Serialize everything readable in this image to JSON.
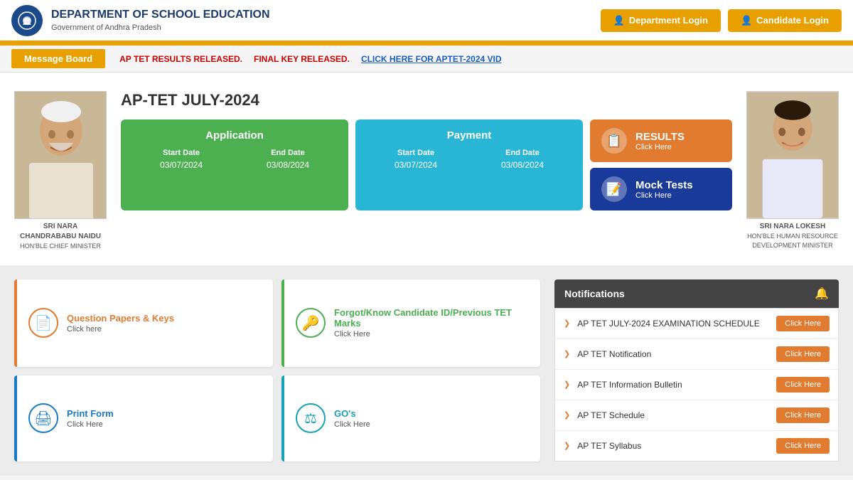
{
  "header": {
    "logo_text": "🏛",
    "title": "DEPARTMENT OF SCHOOL EDUCATION",
    "subtitle": "Government of Andhra Pradesh",
    "dept_login_label": "Department Login",
    "cand_login_label": "Candidate Login",
    "icon_dept": "👤",
    "icon_cand": "👤"
  },
  "message_bar": {
    "board_label": "Message Board",
    "msg1": "AP TET RESULTS RELEASED.",
    "msg2": "FINAL KEY RELEASED.",
    "msg3": "CLICK HERE FOR APTET-2024 VID"
  },
  "aptet": {
    "title": "AP-TET JULY-2024",
    "left_photo": {
      "name": "SRI NARA CHANDRABABU NAIDU",
      "role": "HON'BLE CHIEF MINISTER"
    },
    "right_photo": {
      "name": "SRI NARA LOKESH",
      "role": "HON'BLE HUMAN RESOURCE DEVELOPMENT MINISTER"
    },
    "application_card": {
      "title": "Application",
      "start_label": "Start Date",
      "start_value": "03/07/2024",
      "end_label": "End Date",
      "end_value": "03/08/2024"
    },
    "payment_card": {
      "title": "Payment",
      "start_label": "Start Date",
      "start_value": "03/07/2024",
      "end_label": "End Date",
      "end_value": "03/08/2024"
    },
    "results_card": {
      "title": "RESULTS",
      "sub": "Click Here",
      "icon": "📋"
    },
    "mock_card": {
      "title": "Mock Tests",
      "sub": "Click Here",
      "icon": "📝"
    }
  },
  "quick_links": [
    {
      "id": "qp-keys",
      "icon": "📄",
      "color": "orange",
      "title": "Question Papers & Keys",
      "sub": "Click here"
    },
    {
      "id": "forgot-id",
      "icon": "🔑",
      "color": "green",
      "title": "Forgot/Know Candidate ID/Previous TET Marks",
      "sub": "Click Here"
    },
    {
      "id": "print-form",
      "icon": "🖨",
      "color": "blue",
      "title": "Print Form",
      "sub": "Click Here"
    },
    {
      "id": "gos",
      "icon": "⚖",
      "color": "teal",
      "title": "GO's",
      "sub": "Click Here"
    }
  ],
  "notifications": {
    "title": "Notifications",
    "bell_icon": "🔔",
    "items": [
      {
        "text": "AP TET JULY-2024 EXAMINATION SCHEDULE",
        "btn": "Click Here"
      },
      {
        "text": "AP TET Notification",
        "btn": "Click Here"
      },
      {
        "text": "AP TET Information Bulletin",
        "btn": "Click Here"
      },
      {
        "text": "AP TET Schedule",
        "btn": "Click Here"
      },
      {
        "text": "AP TET Syllabus",
        "btn": "Click Here"
      }
    ]
  }
}
